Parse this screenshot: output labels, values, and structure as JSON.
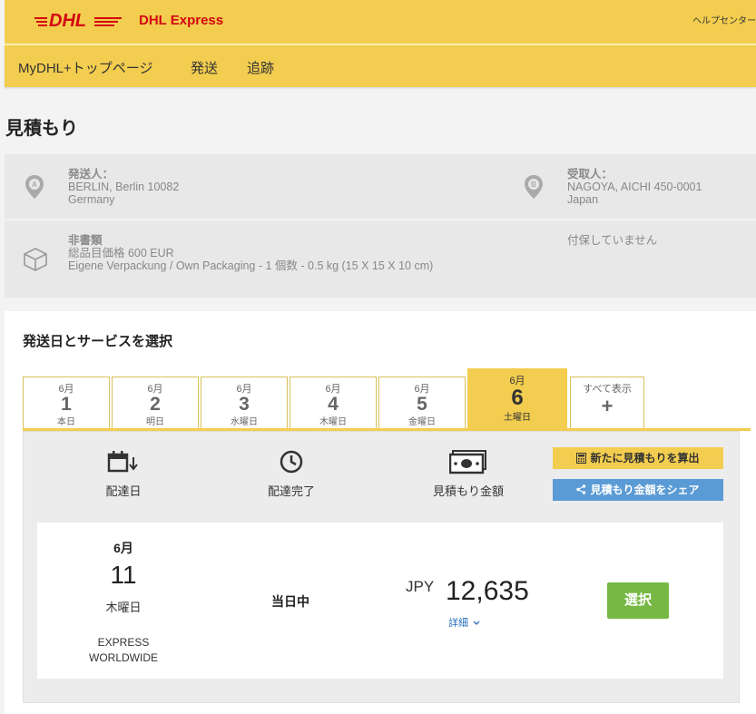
{
  "header": {
    "logo_text": "DHL",
    "brand": "DHL Express",
    "help": "ヘルプセンター",
    "colors": {
      "brand_yellow": "#f2cd4f",
      "brand_red": "#d40511"
    }
  },
  "nav": {
    "items": [
      "MyDHL+トップページ",
      "発送",
      "追跡"
    ]
  },
  "page": {
    "title": "見積もり"
  },
  "summary": {
    "origin": {
      "label": "発送人：",
      "line1": "BERLIN, Berlin 10082",
      "line2": "Germany",
      "icon": "map-pin-a-icon"
    },
    "destination": {
      "label": "受取人：",
      "line1": "NAGOYA, AICHI 450-0001",
      "line2": "Japan",
      "icon": "map-pin-b-icon"
    },
    "shipment": {
      "type": "非書類",
      "value": "総品目価格 600 EUR",
      "packaging": "Eigene Verpackung / Own Packaging - 1 個数 - 0.5 kg (15 X 15 X 10 cm)",
      "icon": "box-icon"
    },
    "insurance": "付保していません"
  },
  "card": {
    "title": "発送日とサービスを選択"
  },
  "tabs": [
    {
      "month": "6月",
      "day": "1",
      "weekday": "本日"
    },
    {
      "month": "6月",
      "day": "2",
      "weekday": "明日"
    },
    {
      "month": "6月",
      "day": "3",
      "weekday": "水曜日"
    },
    {
      "month": "6月",
      "day": "4",
      "weekday": "木曜日"
    },
    {
      "month": "6月",
      "day": "5",
      "weekday": "金曜日"
    },
    {
      "month": "6月",
      "day": "6",
      "weekday": "土曜日",
      "active": true
    }
  ],
  "show_all": {
    "label": "すべて表示",
    "plus": "+"
  },
  "columns": {
    "delivery_date": "配達日",
    "delivery_complete": "配達完了",
    "quote_amount": "見積もり金額"
  },
  "actions": {
    "new_quote": "新たに見積もりを算出",
    "share_quote": "見積もり金額をシェア"
  },
  "result": {
    "month": "6月",
    "day": "11",
    "weekday": "木曜日",
    "service": "EXPRESS WORLDWIDE",
    "delivery": "当日中",
    "currency": "JPY",
    "amount": "12,635",
    "details": "詳細",
    "select": "選択"
  }
}
